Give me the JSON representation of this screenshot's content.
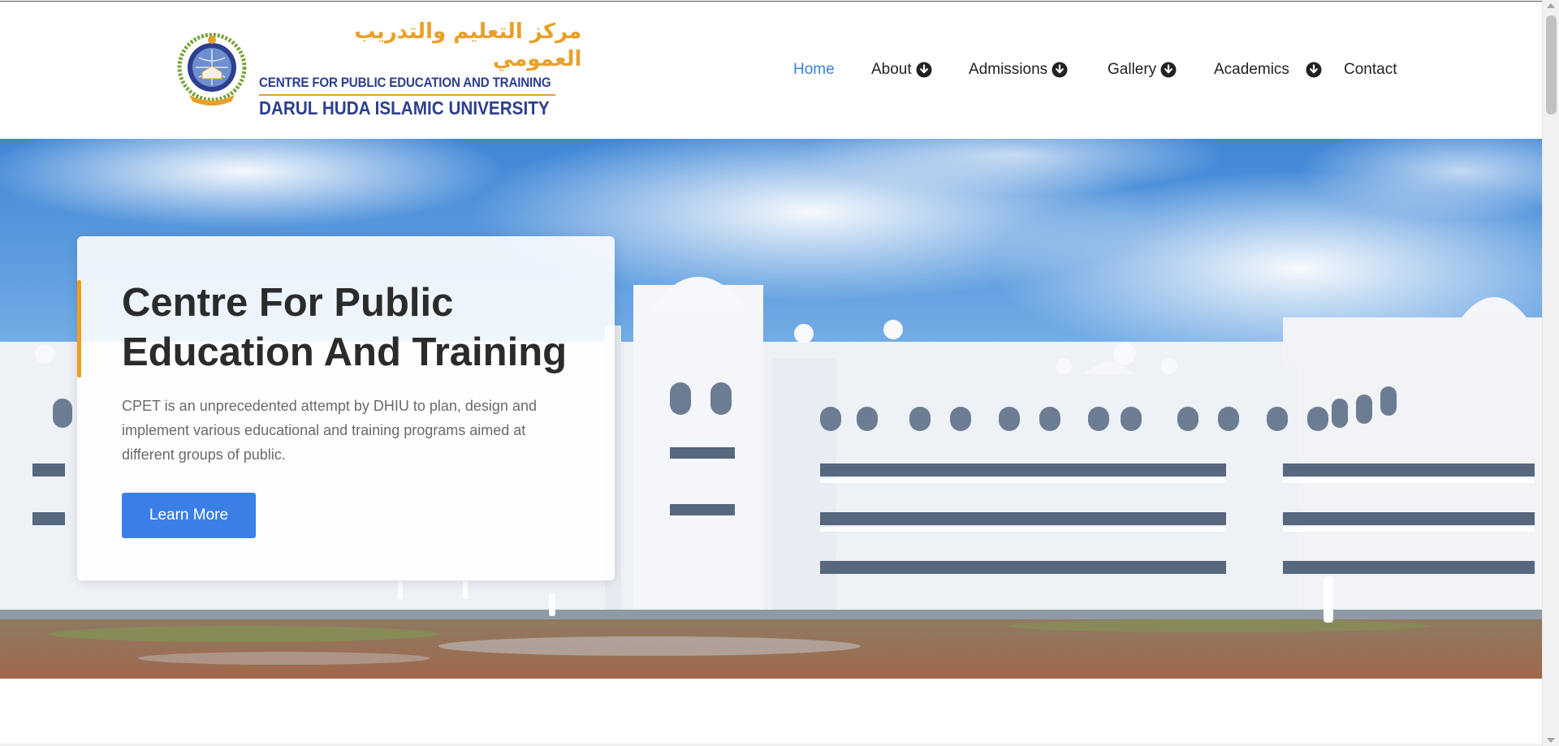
{
  "logo": {
    "arabic": "مركز التعليم والتدريب العمومي",
    "line1": "CENTRE FOR PUBLIC EDUCATION AND TRAINING",
    "line2": "DARUL HUDA ISLAMIC UNIVERSITY",
    "emblem_icon": "university-emblem-icon"
  },
  "nav": {
    "items": [
      {
        "label": "Home",
        "active": true,
        "has_dropdown": false
      },
      {
        "label": "About",
        "active": false,
        "has_dropdown": true
      },
      {
        "label": "Admissions",
        "active": false,
        "has_dropdown": true
      },
      {
        "label": "Gallery",
        "active": false,
        "has_dropdown": true
      },
      {
        "label": "Academics",
        "active": false,
        "has_dropdown": true
      },
      {
        "label": "Contact",
        "active": false,
        "has_dropdown": false
      }
    ],
    "dropdown_icon": "circle-arrow-down-icon"
  },
  "hero": {
    "title": "Centre For Public Education And Training",
    "description": "CPET is an unprecedented attempt by DHIU to plan, design and implement various educational and training programs aimed at different groups of public.",
    "button_label": "Learn More"
  },
  "colors": {
    "accent_blue": "#3b7fe6",
    "nav_active": "#3b7fd9",
    "accent_orange": "#f29c1f",
    "logo_navy": "#2e3f8f",
    "logo_gold": "#e8a02a"
  }
}
